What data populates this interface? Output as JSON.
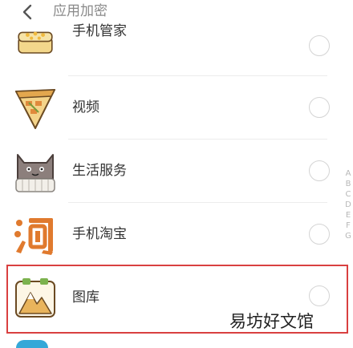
{
  "header": {
    "title": "应用加密"
  },
  "apps": [
    {
      "label": "手机管家",
      "icon": "phone-manager-icon"
    },
    {
      "label": "视频",
      "icon": "video-icon"
    },
    {
      "label": "生活服务",
      "icon": "life-service-icon"
    },
    {
      "label": "手机淘宝",
      "icon": "taobao-icon"
    },
    {
      "label": "图库",
      "icon": "gallery-icon"
    }
  ],
  "index_letters": [
    "A",
    "B",
    "C",
    "D",
    "E",
    "F",
    "G"
  ],
  "watermark": "易坊好文馆",
  "colors": {
    "highlight": "#d94040",
    "divider": "#ececec",
    "radio": "#d4d4d4"
  }
}
